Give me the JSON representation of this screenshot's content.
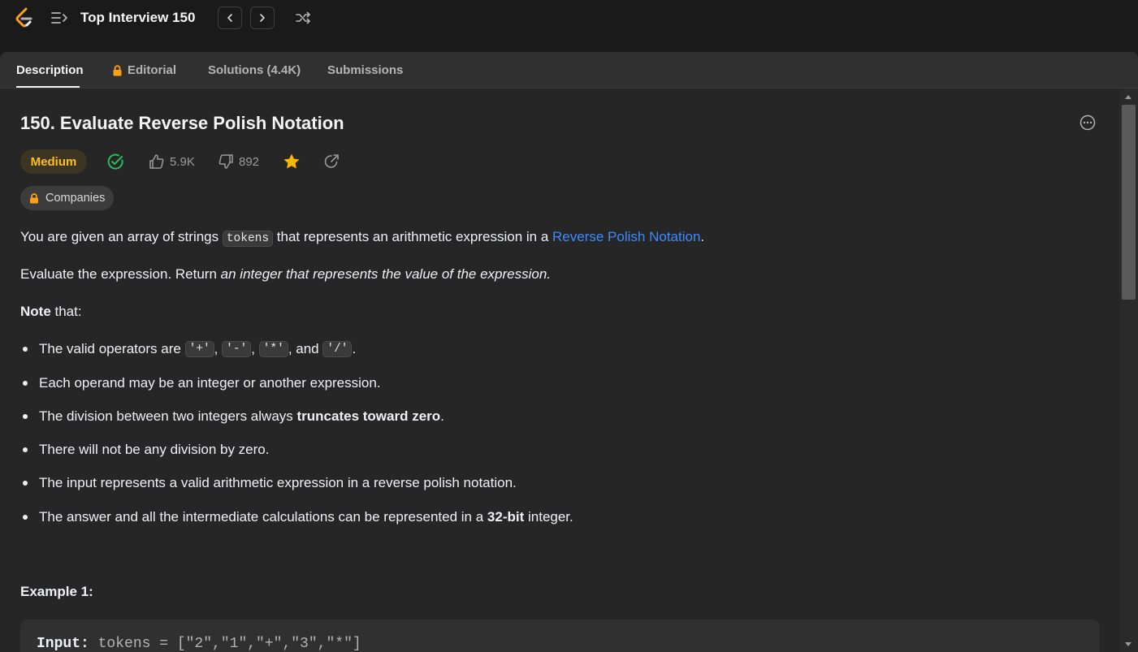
{
  "topbar": {
    "list_title": "Top Interview 150"
  },
  "tabs": [
    {
      "label": "Description",
      "active": true
    },
    {
      "label": "Editorial",
      "locked": true
    },
    {
      "label": "Solutions (4.4K)"
    },
    {
      "label": "Submissions"
    }
  ],
  "problem": {
    "title": "150. Evaluate Reverse Polish Notation",
    "difficulty": "Medium",
    "likes": "5.9K",
    "dislikes": "892",
    "companies_label": "Companies",
    "p1_before": "You are given an array of strings ",
    "p1_code": "tokens",
    "p1_middle": " that represents an arithmetic expression in a ",
    "p1_link": "Reverse Polish Notation",
    "p1_after": ".",
    "p2_before": "Evaluate the expression. Return ",
    "p2_italic": "an integer that represents the value of the expression.",
    "note_bold": "Note",
    "note_rest": " that:",
    "b1_before": "The valid operators are ",
    "b1_op1": "'+'",
    "b1_sep1": ", ",
    "b1_op2": "'-'",
    "b1_sep2": ", ",
    "b1_op3": "'*'",
    "b1_sep3": ", and ",
    "b1_op4": "'/'",
    "b1_after": ".",
    "b2": "Each operand may be an integer or another expression.",
    "b3_before": "The division between two integers always ",
    "b3_bold": "truncates toward zero",
    "b3_after": ".",
    "b4": "There will not be any division by zero.",
    "b5": "The input represents a valid arithmetic expression in a reverse polish notation.",
    "b6_before": "The answer and all the intermediate calculations can be represented in a ",
    "b6_bold": "32-bit",
    "b6_after": " integer.",
    "example1_heading": "Example 1:",
    "example1_input_label": "Input:",
    "example1_input_value": " tokens = [\"2\",\"1\",\"+\",\"3\",\"*\"]"
  },
  "colors": {
    "medium": "#ffc01e",
    "solved": "#2cbb5d",
    "star": "#ffb800",
    "link": "#3d8bfd"
  }
}
